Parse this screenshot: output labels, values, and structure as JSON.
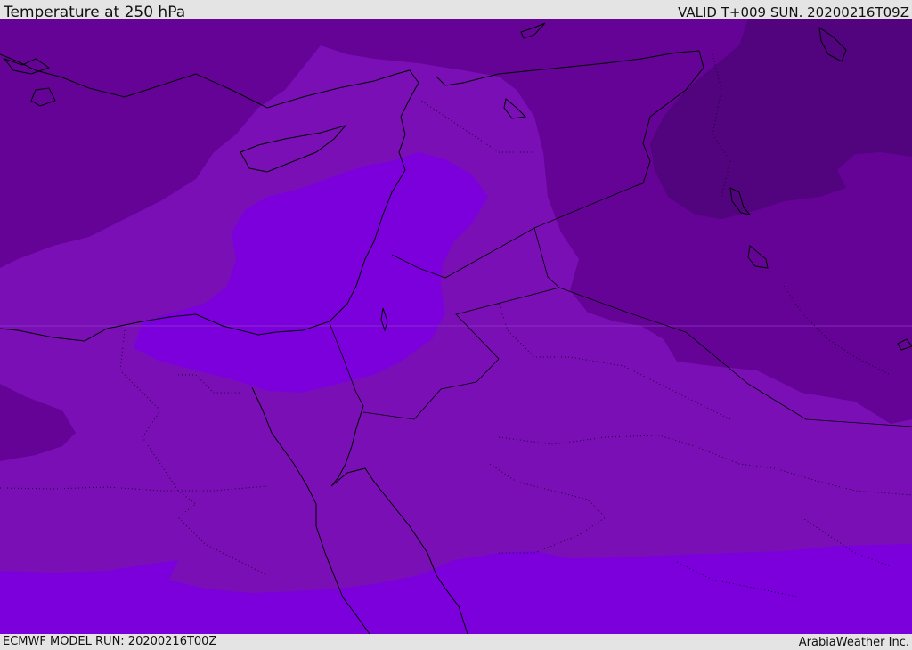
{
  "header": {
    "title": "Temperature at 250 hPa",
    "valid_time": "VALID T+009 SUN. 20200216T09Z"
  },
  "footer": {
    "model_run": "ECMWF MODEL RUN: 20200216T00Z",
    "credit": "ArabiaWeather Inc."
  },
  "colors": {
    "band_coldest": "#52037e",
    "band_cold": "#640396",
    "band_mid": "#7a0fb5",
    "band_warm": "#7c00dc",
    "coastline": "#000000",
    "border": "#000000"
  }
}
